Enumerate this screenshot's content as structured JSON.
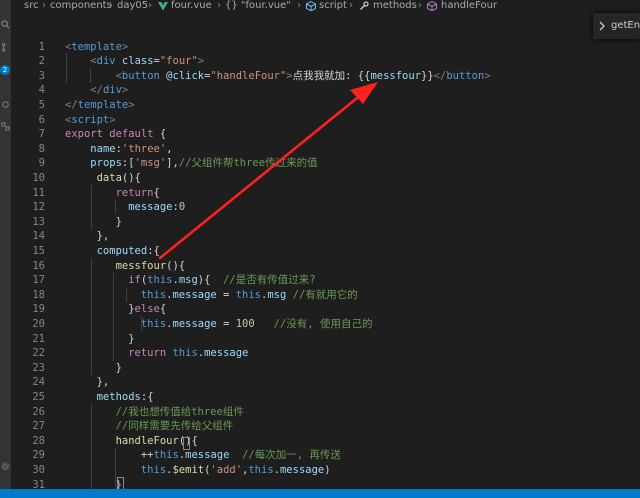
{
  "breadcrumb": {
    "items": [
      "src",
      "components",
      "day05",
      "four.vue",
      "{} \"four.vue\"",
      "script",
      "methods",
      "handleFour"
    ]
  },
  "activity": {
    "badge": "2"
  },
  "find_widget": {
    "text": "getEnc"
  },
  "editor": {
    "line_numbers": [
      "1",
      "2",
      "3",
      "4",
      "5",
      "6",
      "7",
      "8",
      "9",
      "10",
      "11",
      "12",
      "13",
      "14",
      "15",
      "16",
      "17",
      "18",
      "19",
      "20",
      "21",
      "22",
      "23",
      "24",
      "25",
      "26",
      "27",
      "28",
      "29",
      "30",
      "31"
    ],
    "lines": [
      [
        [
          "t-punc",
          "<"
        ],
        [
          "t-tag",
          "template"
        ],
        [
          "t-punc",
          ">"
        ]
      ],
      [
        [
          "t-plain",
          "    "
        ],
        [
          "t-punc",
          "<"
        ],
        [
          "t-tag",
          "div"
        ],
        [
          "t-plain",
          " "
        ],
        [
          "t-attr",
          "class"
        ],
        [
          "t-plain",
          "="
        ],
        [
          "t-str",
          "\"four\""
        ],
        [
          "t-punc",
          ">"
        ]
      ],
      [
        [
          "t-plain",
          "        "
        ],
        [
          "t-punc",
          "<"
        ],
        [
          "t-tag",
          "button"
        ],
        [
          "t-plain",
          " "
        ],
        [
          "t-attr",
          "@click"
        ],
        [
          "t-plain",
          "="
        ],
        [
          "t-str",
          "\"handleFour\""
        ],
        [
          "t-punc",
          ">"
        ],
        [
          "t-txt",
          "点我我就加: "
        ],
        [
          "t-plain",
          "{{"
        ],
        [
          "t-var",
          "messfour"
        ],
        [
          "t-plain",
          "}}"
        ],
        [
          "t-punc",
          "</"
        ],
        [
          "t-tag",
          "button"
        ],
        [
          "t-punc",
          ">"
        ]
      ],
      [
        [
          "t-plain",
          "    "
        ],
        [
          "t-punc",
          "</"
        ],
        [
          "t-tag",
          "div"
        ],
        [
          "t-punc",
          ">"
        ]
      ],
      [
        [
          "t-punc",
          "</"
        ],
        [
          "t-tag",
          "template"
        ],
        [
          "t-punc",
          ">"
        ]
      ],
      [
        [
          "t-punc",
          "<"
        ],
        [
          "t-tag",
          "script"
        ],
        [
          "t-punc",
          ">"
        ]
      ],
      [
        [
          "t-kw",
          "export"
        ],
        [
          "t-plain",
          " "
        ],
        [
          "t-kw",
          "default"
        ],
        [
          "t-plain",
          " {"
        ]
      ],
      [
        [
          "t-plain",
          "    "
        ],
        [
          "t-var",
          "name"
        ],
        [
          "t-plain",
          ":"
        ],
        [
          "t-str",
          "'three'"
        ],
        [
          "t-plain",
          ","
        ]
      ],
      [
        [
          "t-plain",
          "    "
        ],
        [
          "t-var",
          "props"
        ],
        [
          "t-plain",
          ":["
        ],
        [
          "t-str",
          "'msg'"
        ],
        [
          "t-plain",
          "],"
        ],
        [
          "t-com",
          "//父组件帮three传过来的值"
        ]
      ],
      [
        [
          "t-plain",
          "     "
        ],
        [
          "t-fn",
          "data"
        ],
        [
          "t-plain",
          "(){"
        ]
      ],
      [
        [
          "t-plain",
          "        "
        ],
        [
          "t-kw",
          "return"
        ],
        [
          "t-plain",
          "{"
        ]
      ],
      [
        [
          "t-plain",
          "          "
        ],
        [
          "t-var",
          "message"
        ],
        [
          "t-plain",
          ":"
        ],
        [
          "t-num",
          "0"
        ]
      ],
      [
        [
          "t-plain",
          "        }"
        ]
      ],
      [
        [
          "t-plain",
          "     },"
        ]
      ],
      [
        [
          "t-plain",
          "     "
        ],
        [
          "t-var",
          "computed"
        ],
        [
          "t-plain",
          ":{"
        ]
      ],
      [
        [
          "t-plain",
          "        "
        ],
        [
          "t-fn",
          "messfour"
        ],
        [
          "t-plain",
          "(){"
        ]
      ],
      [
        [
          "t-plain",
          "          "
        ],
        [
          "t-kw",
          "if"
        ],
        [
          "t-plain",
          "("
        ],
        [
          "t-this",
          "this"
        ],
        [
          "t-plain",
          "."
        ],
        [
          "t-var",
          "msg"
        ],
        [
          "t-plain",
          "){  "
        ],
        [
          "t-com",
          "//是否有传值过来?"
        ]
      ],
      [
        [
          "t-plain",
          "            "
        ],
        [
          "t-this",
          "this"
        ],
        [
          "t-plain",
          "."
        ],
        [
          "t-var",
          "message"
        ],
        [
          "t-plain",
          " = "
        ],
        [
          "t-this",
          "this"
        ],
        [
          "t-plain",
          "."
        ],
        [
          "t-var",
          "msg"
        ],
        [
          "t-plain",
          " "
        ],
        [
          "t-com",
          "//有就用它的"
        ]
      ],
      [
        [
          "t-plain",
          "          }"
        ],
        [
          "t-kw",
          "else"
        ],
        [
          "t-plain",
          "{"
        ]
      ],
      [
        [
          "t-plain",
          "            "
        ],
        [
          "t-this",
          "this"
        ],
        [
          "t-plain",
          "."
        ],
        [
          "t-var",
          "message"
        ],
        [
          "t-plain",
          " = "
        ],
        [
          "t-num",
          "100"
        ],
        [
          "t-plain",
          "   "
        ],
        [
          "t-com",
          "//没有, 使用自己的"
        ]
      ],
      [
        [
          "t-plain",
          "          }"
        ]
      ],
      [
        [
          "t-plain",
          "          "
        ],
        [
          "t-kw",
          "return"
        ],
        [
          "t-plain",
          " "
        ],
        [
          "t-this",
          "this"
        ],
        [
          "t-plain",
          "."
        ],
        [
          "t-var",
          "message"
        ]
      ],
      [
        [
          "t-plain",
          "        }"
        ]
      ],
      [
        [
          "t-plain",
          "     },"
        ]
      ],
      [
        [
          "t-plain",
          "     "
        ],
        [
          "t-var",
          "methods"
        ],
        [
          "t-plain",
          ":{"
        ]
      ],
      [
        [
          "t-plain",
          "        "
        ],
        [
          "t-com",
          "//我也想传值给three组件"
        ]
      ],
      [
        [
          "t-plain",
          "        "
        ],
        [
          "t-com",
          "//同样需要先传给父组件"
        ]
      ],
      [
        [
          "t-plain",
          "        "
        ],
        [
          "t-fn",
          "handleFour"
        ],
        [
          "t-plain",
          "(){"
        ]
      ],
      [
        [
          "t-plain",
          "            ++"
        ],
        [
          "t-this",
          "this"
        ],
        [
          "t-plain",
          "."
        ],
        [
          "t-var",
          "message"
        ],
        [
          "t-plain",
          "  "
        ],
        [
          "t-com",
          "//每次加一, 再传送"
        ]
      ],
      [
        [
          "t-plain",
          "            "
        ],
        [
          "t-this",
          "this"
        ],
        [
          "t-plain",
          "."
        ],
        [
          "t-fn",
          "$emit"
        ],
        [
          "t-plain",
          "("
        ],
        [
          "t-str",
          "'add'"
        ],
        [
          "t-plain",
          ","
        ],
        [
          "t-this",
          "this"
        ],
        [
          "t-plain",
          "."
        ],
        [
          "t-var",
          "message"
        ],
        [
          "t-plain",
          ")"
        ]
      ],
      [
        [
          "t-plain",
          "        }"
        ]
      ]
    ]
  },
  "colors": {
    "editor_bg": "#1e1e1e",
    "activity_bg": "#333333",
    "statusbar_bg": "#007acc",
    "arrow": "#ff2020"
  }
}
